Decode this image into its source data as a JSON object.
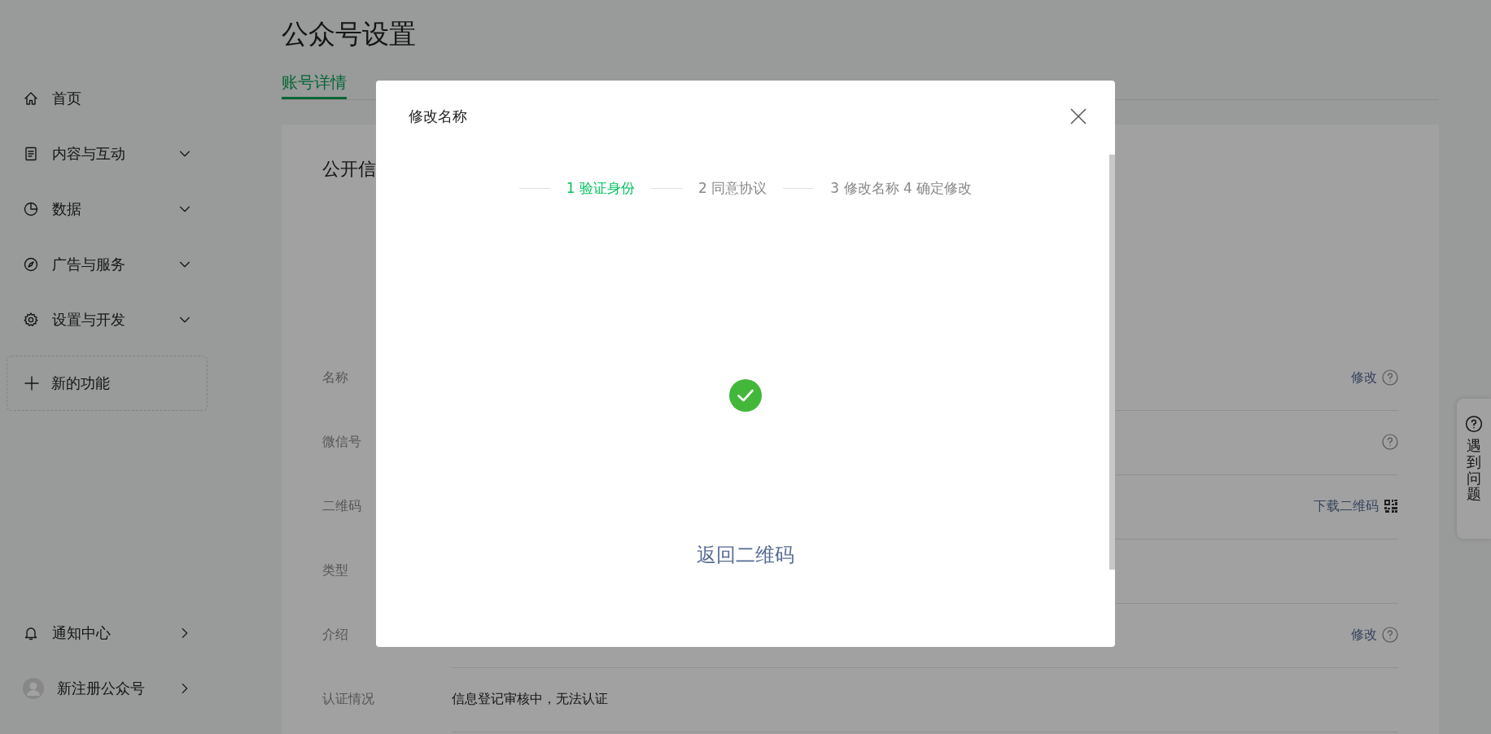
{
  "sidebar": {
    "nav": [
      {
        "label": "首页",
        "expandable": false
      },
      {
        "label": "内容与互动",
        "expandable": true
      },
      {
        "label": "数据",
        "expandable": true
      },
      {
        "label": "广告与服务",
        "expandable": true
      },
      {
        "label": "设置与开发",
        "expandable": true
      }
    ],
    "new_feature": {
      "label": "新的功能"
    },
    "footer": [
      {
        "label": "通知中心"
      },
      {
        "label": "新注册公众号"
      }
    ]
  },
  "page": {
    "title": "公众号设置",
    "tabs": [
      {
        "label": "账号详情",
        "selected": true
      }
    ],
    "section_title": "公开信",
    "rows": [
      {
        "label": "名称",
        "kind": "edit",
        "action": "修改"
      },
      {
        "label": "微信号",
        "kind": "help"
      },
      {
        "label": "二维码",
        "kind": "download",
        "action": "下载二维码"
      },
      {
        "label": "类型",
        "kind": "plain"
      },
      {
        "label": "介绍",
        "kind": "edit",
        "action": "修改"
      },
      {
        "label": "认证情况",
        "kind": "text",
        "value": "信息登记审核中，无法认证"
      }
    ]
  },
  "help_widget": {
    "label": "遇到问题"
  },
  "modal": {
    "title": "修改名称",
    "steps": [
      {
        "label": "1 验证身份",
        "selected": true
      },
      {
        "label": "2 同意协议",
        "selected": false
      },
      {
        "label": "3 修改名称 4 确定修改",
        "selected": false
      }
    ],
    "link": "返回二维码"
  }
}
